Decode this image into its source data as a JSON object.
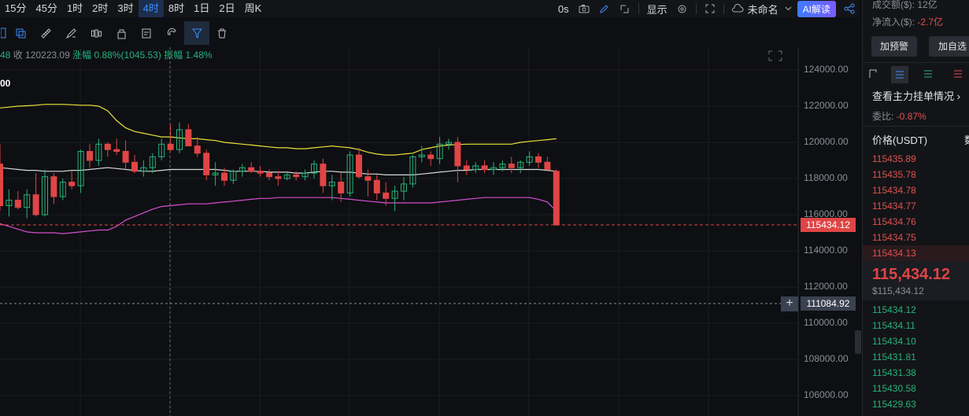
{
  "toolbar": {
    "timeframes": [
      "15分",
      "45分",
      "1时",
      "2时",
      "3时",
      "4时",
      "8时",
      "1日",
      "2日",
      "周K"
    ],
    "active_timeframe": "4时",
    "countdown": "0s",
    "display_label": "显示",
    "layout_name": "未命名",
    "ai_label": "AI解读"
  },
  "legend": {
    "prefix": "48",
    "close": "收 120223.09",
    "change": "涨幅 0.88%(1045.53)",
    "amplitude": "振幅 1.48%"
  },
  "indicator_label": "00",
  "price_axis": {
    "labels": [
      "124000.00",
      "122000.00",
      "120000.00",
      "118000.00",
      "116000.00",
      "114000.00",
      "112000.00",
      "110000.00",
      "108000.00",
      "106000.00"
    ],
    "current_price_tag": "115434.12",
    "cursor_price_tag": "111084.92"
  },
  "colors": {
    "up": "#26b27a",
    "down": "#e04545",
    "bb_upper": "#e8e23a",
    "bb_mid": "#d8d8d8",
    "bb_lower": "#d54fd0",
    "accent": "#3d8cff"
  },
  "panel": {
    "volume": "成交额($): 12亿",
    "net_inflow_label": "净流入($):",
    "net_inflow_value": "-2.7亿",
    "btn_alert": "加预警",
    "btn_watch": "加自选",
    "orderbook_title": "查看主力挂单情况",
    "ratio_label": "委比:",
    "ratio_value": "-0.87%",
    "price_header": "价格(USDT)",
    "qty_header": "数",
    "asks": [
      "115435.89",
      "115435.78",
      "115434.78",
      "115434.77",
      "115434.76",
      "115434.75",
      "115434.13"
    ],
    "last_price": "115,434.12",
    "last_price_usd": "$115,434.12",
    "bids": [
      "115434.12",
      "115434.11",
      "115434.10",
      "115431.81",
      "115431.38",
      "115430.58",
      "115429.63"
    ]
  },
  "chart_data": {
    "type": "candlestick",
    "y_range": [
      105000,
      125500
    ],
    "candles": [
      [
        118800,
        119900,
        116200,
        116500
      ],
      [
        116500,
        117400,
        115900,
        116800
      ],
      [
        116800,
        117300,
        116300,
        116400
      ],
      [
        116400,
        117400,
        115800,
        117100
      ],
      [
        117100,
        118300,
        115900,
        116000
      ],
      [
        116000,
        118500,
        115900,
        118100
      ],
      [
        118100,
        118300,
        116600,
        117000
      ],
      [
        117000,
        118000,
        116800,
        117800
      ],
      [
        117800,
        118400,
        117400,
        117600
      ],
      [
        117600,
        119600,
        117200,
        119500
      ],
      [
        119500,
        119900,
        118600,
        119000
      ],
      [
        119000,
        120200,
        118700,
        119900
      ],
      [
        119900,
        120000,
        119200,
        119600
      ],
      [
        119600,
        120200,
        119300,
        119500
      ],
      [
        119500,
        120100,
        118500,
        118900
      ],
      [
        118900,
        119300,
        118300,
        118400
      ],
      [
        118400,
        119000,
        118100,
        118600
      ],
      [
        118600,
        119400,
        118300,
        119200
      ],
      [
        119200,
        120200,
        119000,
        119900
      ],
      [
        119900,
        121000,
        119500,
        119600
      ],
      [
        119600,
        121100,
        119400,
        120700
      ],
      [
        120700,
        121000,
        119800,
        119800
      ],
      [
        119800,
        120300,
        119200,
        119400
      ],
      [
        119400,
        119600,
        117900,
        118200
      ],
      [
        118200,
        118900,
        117600,
        118300
      ],
      [
        118300,
        118600,
        117600,
        117900
      ],
      [
        117900,
        118500,
        117700,
        118400
      ],
      [
        118400,
        118800,
        118100,
        118600
      ],
      [
        118600,
        118900,
        118300,
        118400
      ],
      [
        118400,
        118700,
        118100,
        118300
      ],
      [
        118300,
        118500,
        117900,
        118100
      ],
      [
        118100,
        118400,
        117600,
        118000
      ],
      [
        118000,
        118300,
        117900,
        118200
      ],
      [
        118200,
        118400,
        117900,
        118100
      ],
      [
        118100,
        118500,
        117900,
        118300
      ],
      [
        118300,
        119000,
        118000,
        118800
      ],
      [
        118800,
        119100,
        117200,
        117600
      ],
      [
        117600,
        118200,
        116800,
        117800
      ],
      [
        117800,
        118300,
        116700,
        117200
      ],
      [
        117200,
        119500,
        117000,
        119300
      ],
      [
        119300,
        119700,
        118000,
        118100
      ],
      [
        118100,
        118500,
        117000,
        117900
      ],
      [
        117900,
        118200,
        116800,
        117200
      ],
      [
        117200,
        117800,
        116500,
        116900
      ],
      [
        116900,
        117600,
        116200,
        117300
      ],
      [
        117300,
        118100,
        116800,
        117700
      ],
      [
        117700,
        119300,
        117500,
        119200
      ],
      [
        119200,
        119800,
        118900,
        119300
      ],
      [
        119300,
        119500,
        118700,
        119100
      ],
      [
        119100,
        120300,
        118800,
        119900
      ],
      [
        119900,
        120200,
        119600,
        120000
      ],
      [
        120000,
        120300,
        117800,
        118700
      ],
      [
        118700,
        119000,
        118200,
        118500
      ],
      [
        118500,
        118900,
        118300,
        118700
      ],
      [
        118700,
        119000,
        118300,
        118500
      ],
      [
        118500,
        118900,
        118200,
        118600
      ],
      [
        118600,
        119000,
        118400,
        118800
      ],
      [
        118800,
        119200,
        118300,
        118600
      ],
      [
        118600,
        119000,
        118300,
        118900
      ],
      [
        118900,
        119500,
        118700,
        119200
      ],
      [
        119200,
        119400,
        118600,
        118900
      ],
      [
        118900,
        119200,
        118400,
        118500
      ],
      [
        118400,
        118500,
        115400,
        115434
      ]
    ],
    "bollinger": {
      "upper": [
        121900,
        121950,
        122000,
        122020,
        122050,
        122100,
        122100,
        122100,
        122080,
        122050,
        122050,
        122000,
        121750,
        121200,
        120800,
        120600,
        120500,
        120400,
        120300,
        120300,
        120250,
        120200,
        120200,
        120150,
        120100,
        120000,
        119950,
        119900,
        119850,
        119800,
        119750,
        119700,
        119700,
        119650,
        119650,
        119700,
        119750,
        119800,
        119750,
        119700,
        119600,
        119450,
        119350,
        119300,
        119300,
        119350,
        119400,
        119600,
        119700,
        119800,
        119850,
        119880,
        119900,
        119900,
        119900,
        119900,
        119900,
        119900,
        120000,
        120050,
        120100,
        120150,
        120200
      ],
      "mid": [
        118600,
        118550,
        118500,
        118450,
        118450,
        118400,
        118400,
        118400,
        118450,
        118450,
        118500,
        118550,
        118600,
        118550,
        118500,
        118450,
        118400,
        118400,
        118450,
        118500,
        118500,
        118500,
        118500,
        118500,
        118500,
        118450,
        118400,
        118400,
        118400,
        118400,
        118350,
        118350,
        118350,
        118300,
        118300,
        118350,
        118400,
        118400,
        118350,
        118350,
        118300,
        118250,
        118250,
        118200,
        118200,
        118200,
        118200,
        118250,
        118300,
        118350,
        118400,
        118450,
        118450,
        118500,
        118500,
        118500,
        118500,
        118500,
        118500,
        118500,
        118500,
        118450,
        118400
      ],
      "lower": [
        115500,
        115350,
        115200,
        115050,
        115000,
        115000,
        115000,
        114950,
        115000,
        115050,
        115100,
        115150,
        115150,
        115350,
        115700,
        115900,
        116100,
        116300,
        116450,
        116500,
        116550,
        116600,
        116600,
        116600,
        116650,
        116700,
        116750,
        116800,
        116850,
        116900,
        116900,
        116950,
        116950,
        116950,
        116950,
        116950,
        116950,
        116950,
        116900,
        116850,
        116800,
        116750,
        116700,
        116650,
        116650,
        116650,
        116650,
        116650,
        116650,
        116700,
        116750,
        116800,
        116850,
        116900,
        116950,
        116950,
        116950,
        116950,
        116950,
        116950,
        116850,
        116700,
        116200
      ]
    },
    "current_price": 115434.12,
    "cursor_price": 111084.92
  }
}
